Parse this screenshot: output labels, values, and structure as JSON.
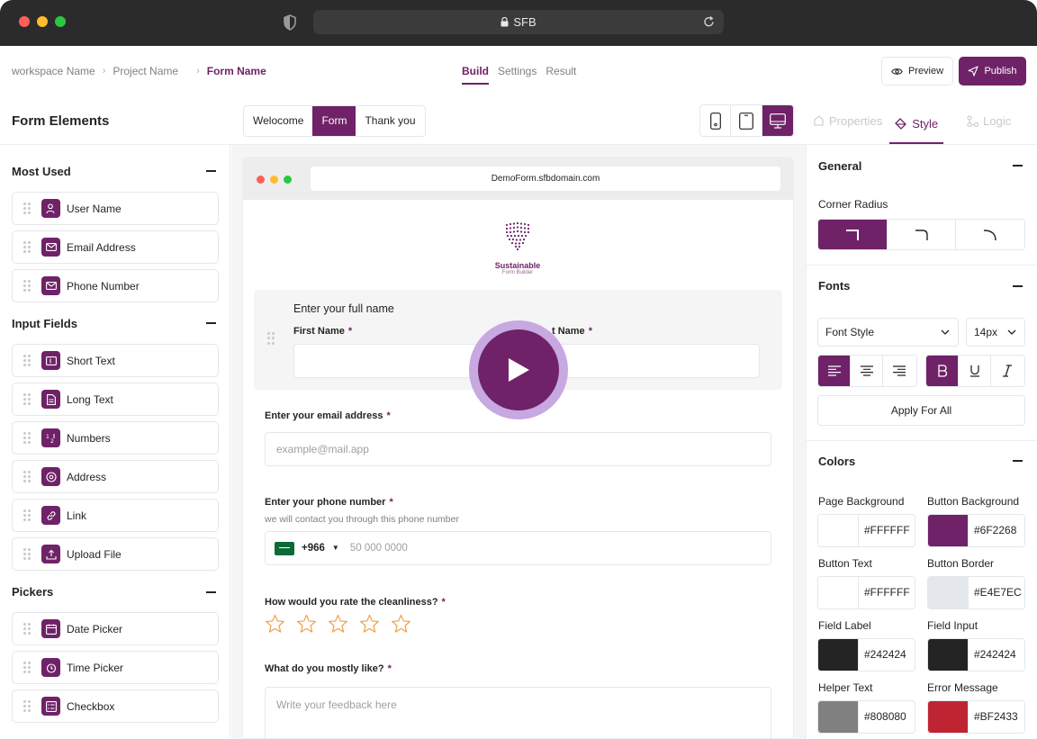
{
  "browser": {
    "url": "SFB"
  },
  "breadcrumb": {
    "workspace": "workspace Name",
    "project": "Project Name",
    "form": "Form Name"
  },
  "top_tabs": [
    "Build",
    "Settings",
    "Result"
  ],
  "actions": {
    "preview": "Preview",
    "publish": "Publish"
  },
  "left": {
    "title": "Form Elements",
    "sections": [
      {
        "title": "Most Used",
        "items": [
          "User Name",
          "Email Address",
          "Phone Number"
        ]
      },
      {
        "title": "Input Fields",
        "items": [
          "Short Text",
          "Long Text",
          "Numbers",
          "Address",
          "Link",
          "Upload File"
        ]
      },
      {
        "title": "Pickers",
        "items": [
          "Date Picker",
          "Time Picker",
          "Checkbox"
        ]
      }
    ]
  },
  "page_tabs": [
    "Welocome",
    "Form",
    "Thank you"
  ],
  "right_tabs": [
    "Properties",
    "Style",
    "Logic"
  ],
  "preview": {
    "url": "DemoForm.sfbdomain.com",
    "logo_title": "Sustainable",
    "logo_sub": "Form Builder",
    "q_fullname": "Enter your full name",
    "first_name": "First Name",
    "last_name": "t Name",
    "q_email": "Enter your email address",
    "email_placeholder": "example@mail.app",
    "q_phone": "Enter your phone number",
    "phone_helper": "we will contact you through this phone number",
    "phone_code": "+966",
    "phone_placeholder": "50 000 0000",
    "q_rating": "How would you rate the cleanliness?",
    "q_like": "What do you mostly like?",
    "like_placeholder": "Write your feedback here",
    "required_mark": "*",
    "stars": 5
  },
  "general": {
    "title": "General",
    "corner_radius": "Corner Radius"
  },
  "fonts": {
    "title": "Fonts",
    "font_style": "Font Style",
    "font_size": "14px",
    "apply": "Apply For All"
  },
  "colors": {
    "title": "Colors",
    "items": [
      {
        "label": "Page Background",
        "hex": "#FFFFFF"
      },
      {
        "label": "Button Background",
        "hex": "#6F2268"
      },
      {
        "label": "Button Text",
        "hex": "#FFFFFF"
      },
      {
        "label": "Button Border",
        "hex": "#E4E7EC"
      },
      {
        "label": "Field Label",
        "hex": "#242424"
      },
      {
        "label": "Field Input",
        "hex": "#242424"
      },
      {
        "label": "Helper Text",
        "hex": "#808080"
      },
      {
        "label": "Error Message",
        "hex": "#BF2433"
      }
    ]
  },
  "theme": {
    "accent": "#6f2268"
  }
}
